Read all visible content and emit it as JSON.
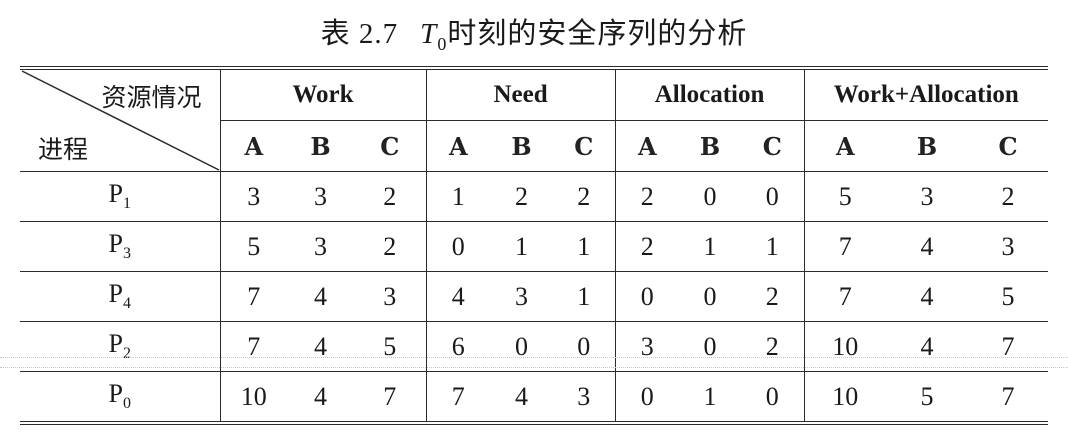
{
  "caption": {
    "number": "表 2.7",
    "t": "T",
    "t_sub": "0",
    "title": "时刻的安全序列的分析"
  },
  "header": {
    "corner_top": "资源情况",
    "corner_bottom": "进程",
    "groups": [
      "Work",
      "Need",
      "Allocation",
      "Work+Allocation"
    ],
    "subcols": [
      "A",
      "B",
      "C"
    ]
  },
  "rows": [
    {
      "p": "P",
      "sub": "1",
      "work": [
        "3",
        "3",
        "2"
      ],
      "need": [
        "1",
        "2",
        "2"
      ],
      "alloc": [
        "2",
        "0",
        "0"
      ],
      "wa": [
        "5",
        "3",
        "2"
      ]
    },
    {
      "p": "P",
      "sub": "3",
      "work": [
        "5",
        "3",
        "2"
      ],
      "need": [
        "0",
        "1",
        "1"
      ],
      "alloc": [
        "2",
        "1",
        "1"
      ],
      "wa": [
        "7",
        "4",
        "3"
      ]
    },
    {
      "p": "P",
      "sub": "4",
      "work": [
        "7",
        "4",
        "3"
      ],
      "need": [
        "4",
        "3",
        "1"
      ],
      "alloc": [
        "0",
        "0",
        "2"
      ],
      "wa": [
        "7",
        "4",
        "5"
      ]
    },
    {
      "p": "P",
      "sub": "2",
      "work": [
        "7",
        "4",
        "5"
      ],
      "need": [
        "6",
        "0",
        "0"
      ],
      "alloc": [
        "3",
        "0",
        "2"
      ],
      "wa": [
        "10",
        "4",
        "7"
      ]
    },
    {
      "p": "P",
      "sub": "0",
      "work": [
        "10",
        "4",
        "7"
      ],
      "need": [
        "7",
        "4",
        "3"
      ],
      "alloc": [
        "0",
        "1",
        "0"
      ],
      "wa": [
        "10",
        "5",
        "7"
      ]
    }
  ]
}
